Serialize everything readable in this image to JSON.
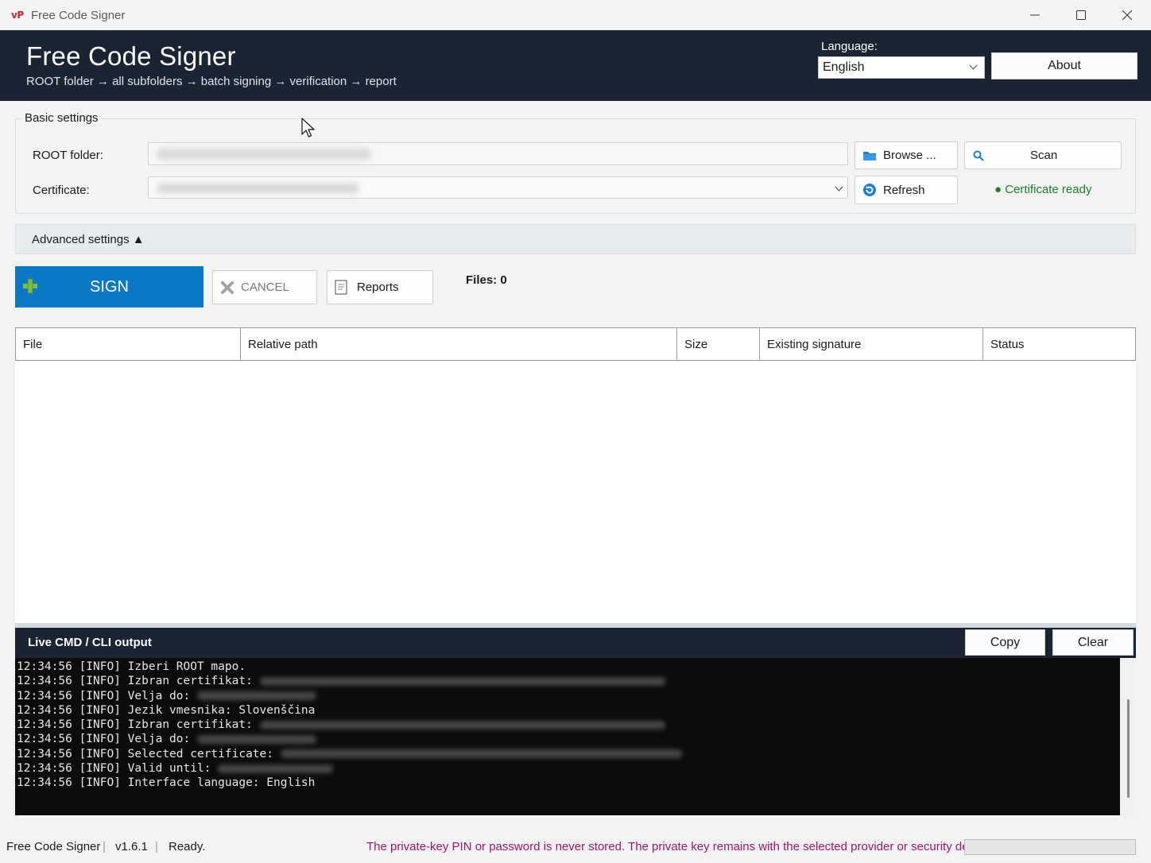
{
  "window": {
    "icon_text": "vP",
    "title": "Free Code Signer"
  },
  "header": {
    "app_name": "Free Code Signer",
    "subtitle": "ROOT folder → all subfolders → batch signing → verification → report",
    "language_label": "Language:",
    "language_value": "English",
    "about_label": "About"
  },
  "basic_settings": {
    "title": "Basic settings",
    "root_label": "ROOT folder:",
    "root_value": "",
    "certificate_label": "Certificate:",
    "certificate_value": "",
    "browse_label": "Browse ...",
    "scan_label": "Scan",
    "refresh_label": "Refresh",
    "cert_status": "● Certificate ready"
  },
  "advanced": {
    "label": "Advanced settings ▲"
  },
  "actions": {
    "sign_label": "SIGN",
    "cancel_label": "CANCEL",
    "reports_label": "Reports",
    "files_count": "Files: 0"
  },
  "table": {
    "columns": [
      "File",
      "Relative path",
      "Size",
      "Existing signature",
      "Status"
    ],
    "rows": []
  },
  "console": {
    "title": "Live CMD / CLI output",
    "copy_label": "Copy",
    "clear_label": "Clear",
    "lines": [
      "12:34:56 [INFO] Izberi ROOT mapo.",
      "12:34:56 [INFO] Izbran certifikat: ",
      "12:34:56 [INFO] Velja do: ",
      "12:34:56 [INFO] Jezik vmesnika: Slovenščina",
      "12:34:56 [INFO] Izbran certifikat: ",
      "12:34:56 [INFO] Velja do: ",
      "12:34:56 [INFO] Selected certificate: ",
      "12:34:56 [INFO] Valid until: ",
      "12:34:56 [INFO] Interface language: English"
    ]
  },
  "statusbar": {
    "app": "Free Code Signer",
    "version": "v1.6.1",
    "state": "Ready.",
    "notice": "The private-key PIN or password is never stored. The private key remains with the selected provider or security device.",
    "progress": 0
  },
  "colors": {
    "header_bg": "#1b2432",
    "sign_blue": "#0a78c7",
    "ready_green": "#1e7d2e",
    "notice_magenta": "#a0156e"
  }
}
